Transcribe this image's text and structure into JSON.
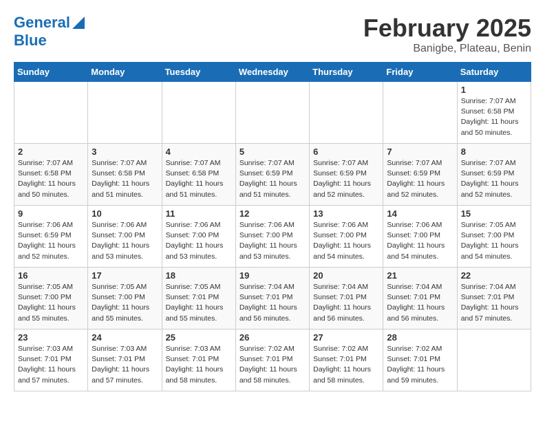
{
  "header": {
    "logo_line1": "General",
    "logo_line2": "Blue",
    "month": "February 2025",
    "location": "Banigbe, Plateau, Benin"
  },
  "days_of_week": [
    "Sunday",
    "Monday",
    "Tuesday",
    "Wednesday",
    "Thursday",
    "Friday",
    "Saturday"
  ],
  "weeks": [
    [
      {
        "day": "",
        "info": ""
      },
      {
        "day": "",
        "info": ""
      },
      {
        "day": "",
        "info": ""
      },
      {
        "day": "",
        "info": ""
      },
      {
        "day": "",
        "info": ""
      },
      {
        "day": "",
        "info": ""
      },
      {
        "day": "1",
        "info": "Sunrise: 7:07 AM\nSunset: 6:58 PM\nDaylight: 11 hours\nand 50 minutes."
      }
    ],
    [
      {
        "day": "2",
        "info": "Sunrise: 7:07 AM\nSunset: 6:58 PM\nDaylight: 11 hours\nand 50 minutes."
      },
      {
        "day": "3",
        "info": "Sunrise: 7:07 AM\nSunset: 6:58 PM\nDaylight: 11 hours\nand 51 minutes."
      },
      {
        "day": "4",
        "info": "Sunrise: 7:07 AM\nSunset: 6:58 PM\nDaylight: 11 hours\nand 51 minutes."
      },
      {
        "day": "5",
        "info": "Sunrise: 7:07 AM\nSunset: 6:59 PM\nDaylight: 11 hours\nand 51 minutes."
      },
      {
        "day": "6",
        "info": "Sunrise: 7:07 AM\nSunset: 6:59 PM\nDaylight: 11 hours\nand 52 minutes."
      },
      {
        "day": "7",
        "info": "Sunrise: 7:07 AM\nSunset: 6:59 PM\nDaylight: 11 hours\nand 52 minutes."
      },
      {
        "day": "8",
        "info": "Sunrise: 7:07 AM\nSunset: 6:59 PM\nDaylight: 11 hours\nand 52 minutes."
      }
    ],
    [
      {
        "day": "9",
        "info": "Sunrise: 7:06 AM\nSunset: 6:59 PM\nDaylight: 11 hours\nand 52 minutes."
      },
      {
        "day": "10",
        "info": "Sunrise: 7:06 AM\nSunset: 7:00 PM\nDaylight: 11 hours\nand 53 minutes."
      },
      {
        "day": "11",
        "info": "Sunrise: 7:06 AM\nSunset: 7:00 PM\nDaylight: 11 hours\nand 53 minutes."
      },
      {
        "day": "12",
        "info": "Sunrise: 7:06 AM\nSunset: 7:00 PM\nDaylight: 11 hours\nand 53 minutes."
      },
      {
        "day": "13",
        "info": "Sunrise: 7:06 AM\nSunset: 7:00 PM\nDaylight: 11 hours\nand 54 minutes."
      },
      {
        "day": "14",
        "info": "Sunrise: 7:06 AM\nSunset: 7:00 PM\nDaylight: 11 hours\nand 54 minutes."
      },
      {
        "day": "15",
        "info": "Sunrise: 7:05 AM\nSunset: 7:00 PM\nDaylight: 11 hours\nand 54 minutes."
      }
    ],
    [
      {
        "day": "16",
        "info": "Sunrise: 7:05 AM\nSunset: 7:00 PM\nDaylight: 11 hours\nand 55 minutes."
      },
      {
        "day": "17",
        "info": "Sunrise: 7:05 AM\nSunset: 7:00 PM\nDaylight: 11 hours\nand 55 minutes."
      },
      {
        "day": "18",
        "info": "Sunrise: 7:05 AM\nSunset: 7:01 PM\nDaylight: 11 hours\nand 55 minutes."
      },
      {
        "day": "19",
        "info": "Sunrise: 7:04 AM\nSunset: 7:01 PM\nDaylight: 11 hours\nand 56 minutes."
      },
      {
        "day": "20",
        "info": "Sunrise: 7:04 AM\nSunset: 7:01 PM\nDaylight: 11 hours\nand 56 minutes."
      },
      {
        "day": "21",
        "info": "Sunrise: 7:04 AM\nSunset: 7:01 PM\nDaylight: 11 hours\nand 56 minutes."
      },
      {
        "day": "22",
        "info": "Sunrise: 7:04 AM\nSunset: 7:01 PM\nDaylight: 11 hours\nand 57 minutes."
      }
    ],
    [
      {
        "day": "23",
        "info": "Sunrise: 7:03 AM\nSunset: 7:01 PM\nDaylight: 11 hours\nand 57 minutes."
      },
      {
        "day": "24",
        "info": "Sunrise: 7:03 AM\nSunset: 7:01 PM\nDaylight: 11 hours\nand 57 minutes."
      },
      {
        "day": "25",
        "info": "Sunrise: 7:03 AM\nSunset: 7:01 PM\nDaylight: 11 hours\nand 58 minutes."
      },
      {
        "day": "26",
        "info": "Sunrise: 7:02 AM\nSunset: 7:01 PM\nDaylight: 11 hours\nand 58 minutes."
      },
      {
        "day": "27",
        "info": "Sunrise: 7:02 AM\nSunset: 7:01 PM\nDaylight: 11 hours\nand 58 minutes."
      },
      {
        "day": "28",
        "info": "Sunrise: 7:02 AM\nSunset: 7:01 PM\nDaylight: 11 hours\nand 59 minutes."
      },
      {
        "day": "",
        "info": ""
      }
    ]
  ]
}
